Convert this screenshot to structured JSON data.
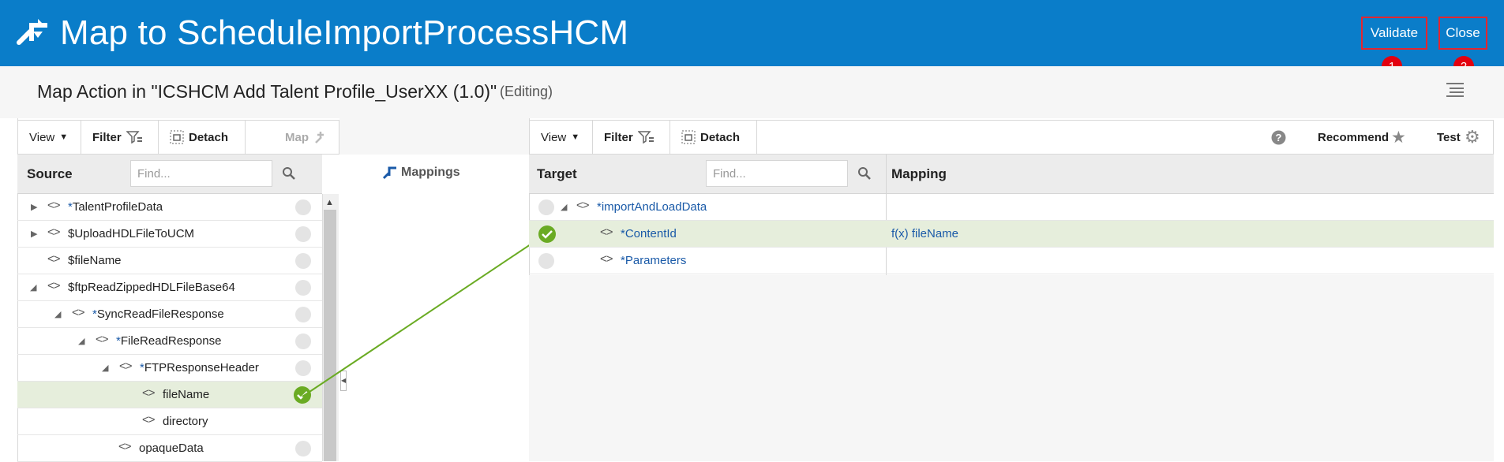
{
  "header": {
    "title": "Map to ScheduleImportProcessHCM",
    "validate_label": "Validate",
    "close_label": "Close",
    "badge1": "1",
    "badge2": "2",
    "accent": "#0a7dc9"
  },
  "subheader": {
    "title": "Map Action in \"ICSHCM Add Talent Profile_UserXX (1.0)\"",
    "status": "(Editing)"
  },
  "source_toolbar": {
    "view": "View",
    "filter": "Filter",
    "detach": "Detach",
    "map": "Map"
  },
  "source": {
    "header": "Source",
    "find_placeholder": "Find...",
    "rows": [
      {
        "prefix": "*",
        "name": "TalentProfileData",
        "twisty": "collapsed"
      },
      {
        "prefix": "",
        "name": "$UploadHDLFileToUCM",
        "twisty": "collapsed"
      },
      {
        "prefix": "",
        "name": "$fileName",
        "twisty": "none"
      },
      {
        "prefix": "",
        "name": "$ftpReadZippedHDLFileBase64",
        "twisty": "expanded"
      },
      {
        "prefix": "*",
        "name": "SyncReadFileResponse",
        "twisty": "expanded"
      },
      {
        "prefix": "*",
        "name": "FileReadResponse",
        "twisty": "expanded"
      },
      {
        "prefix": "*",
        "name": "FTPResponseHeader",
        "twisty": "expanded"
      },
      {
        "prefix": "",
        "name": "fileName",
        "twisty": "none",
        "mapped": true
      },
      {
        "prefix": "",
        "name": "directory",
        "twisty": "none"
      },
      {
        "prefix": "",
        "name": "opaqueData",
        "twisty": "none"
      }
    ]
  },
  "middle": {
    "mappings_label": "Mappings"
  },
  "target_toolbar": {
    "view": "View",
    "filter": "Filter",
    "detach": "Detach",
    "recommend": "Recommend",
    "test": "Test"
  },
  "target": {
    "header": "Target",
    "find_placeholder": "Find...",
    "mapping_header": "Mapping",
    "rows": [
      {
        "prefix": "*",
        "name": "importAndLoadData",
        "mapping": ""
      },
      {
        "prefix": "*",
        "name": "ContentId",
        "mapping": "f(x) fileName",
        "mapped": true
      },
      {
        "prefix": "*",
        "name": "Parameters",
        "mapping": ""
      }
    ]
  },
  "icons": [
    "map-action-icon",
    "hamburger-menu-icon",
    "filter-icon",
    "detach-icon",
    "map-plus-icon",
    "search-icon",
    "mappings-icon",
    "help-icon",
    "star-icon",
    "gear-icon",
    "check-icon",
    "expand-triangle-icon",
    "collapse-triangle-icon",
    "element-code-icon"
  ],
  "colors": {
    "mapped": "#6aab23",
    "link_text": "#1a5aa8",
    "highlight_row": "#e6eedc",
    "annotation": "#e3262f"
  }
}
